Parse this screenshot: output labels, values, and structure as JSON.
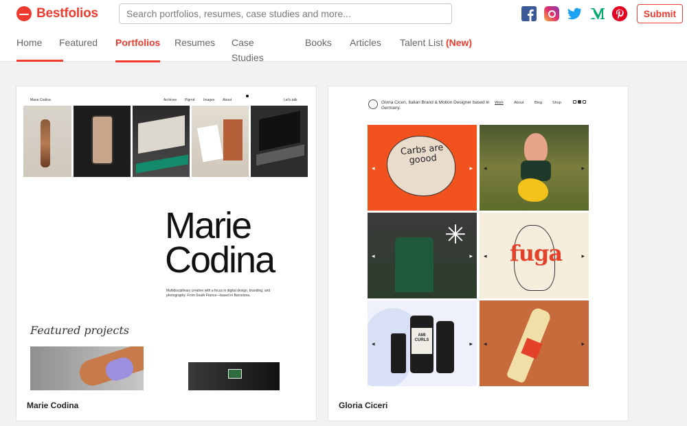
{
  "brand": {
    "name": "Bestfolios"
  },
  "search": {
    "placeholder": "Search portfolios, resumes, case studies and more..."
  },
  "socials": [
    "facebook-icon",
    "instagram-icon",
    "twitter-icon",
    "medium-icon",
    "pinterest-icon"
  ],
  "submit_label": "Submit",
  "nav": {
    "tabs": [
      {
        "label": "Home",
        "active": false
      },
      {
        "label": "Featured",
        "active": false
      },
      {
        "label": "Portfolios",
        "active": true
      },
      {
        "label": "Resumes",
        "active": false
      },
      {
        "label": "Case Studies",
        "active": false
      },
      {
        "label": "Books",
        "active": false
      },
      {
        "label": "Articles",
        "active": false
      },
      {
        "label": "Talent List",
        "badge": "(New)",
        "active": false
      }
    ]
  },
  "colors": {
    "accent": "#ef3b2d"
  },
  "cards": [
    {
      "title": "Marie Codina",
      "preview": {
        "site_name": "Marie Codina",
        "menu": [
          "Archives",
          "Plgrnd",
          "Images",
          "About"
        ],
        "cta": "Let's talk",
        "headline_1": "Marie",
        "headline_2": "Codina",
        "description": "Multidisciplinary creative with a focus in digital design, branding, and photography. From South France—based in Barcelona.",
        "featured": "Featured projects"
      }
    },
    {
      "title": "Gloria Ciceri",
      "preview": {
        "heading": "Gloria Ciceri, Italian Brand & Motion Designer based in Germany.",
        "menu": [
          "Work",
          "About",
          "Blog",
          "Shop"
        ],
        "tile_1_text": "Carbs are goood",
        "tile_4_text": "fuga",
        "tile_5_text": "AMI CURLS"
      }
    }
  ]
}
